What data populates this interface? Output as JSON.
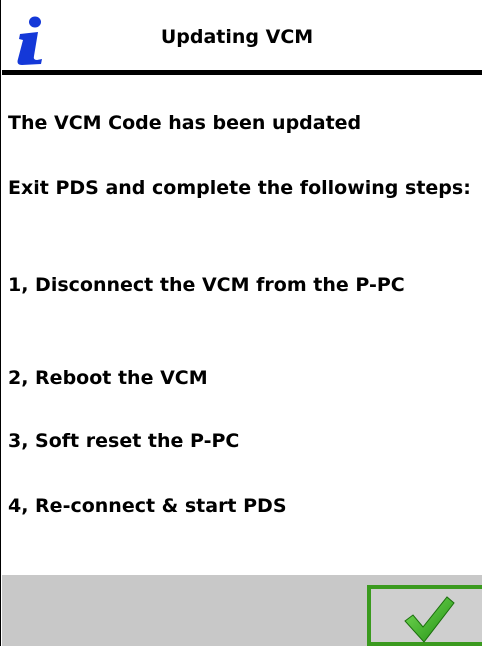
{
  "dialog": {
    "title": "Updating VCM",
    "icon": "info-icon"
  },
  "message": {
    "status": "The VCM Code has been updated",
    "instruction": "Exit PDS and complete the following steps:",
    "steps": [
      "1, Disconnect the VCM from the P-PC",
      "2, Reboot the VCM",
      "3, Soft reset the P-PC",
      "4, Re-connect & start PDS"
    ]
  },
  "footer": {
    "ok_icon": "checkmark-icon"
  },
  "colors": {
    "info_icon": "#1438d8",
    "footer_bg": "#c8c8c8",
    "ok_border": "#3a9a1e",
    "check": "#34b81e"
  }
}
